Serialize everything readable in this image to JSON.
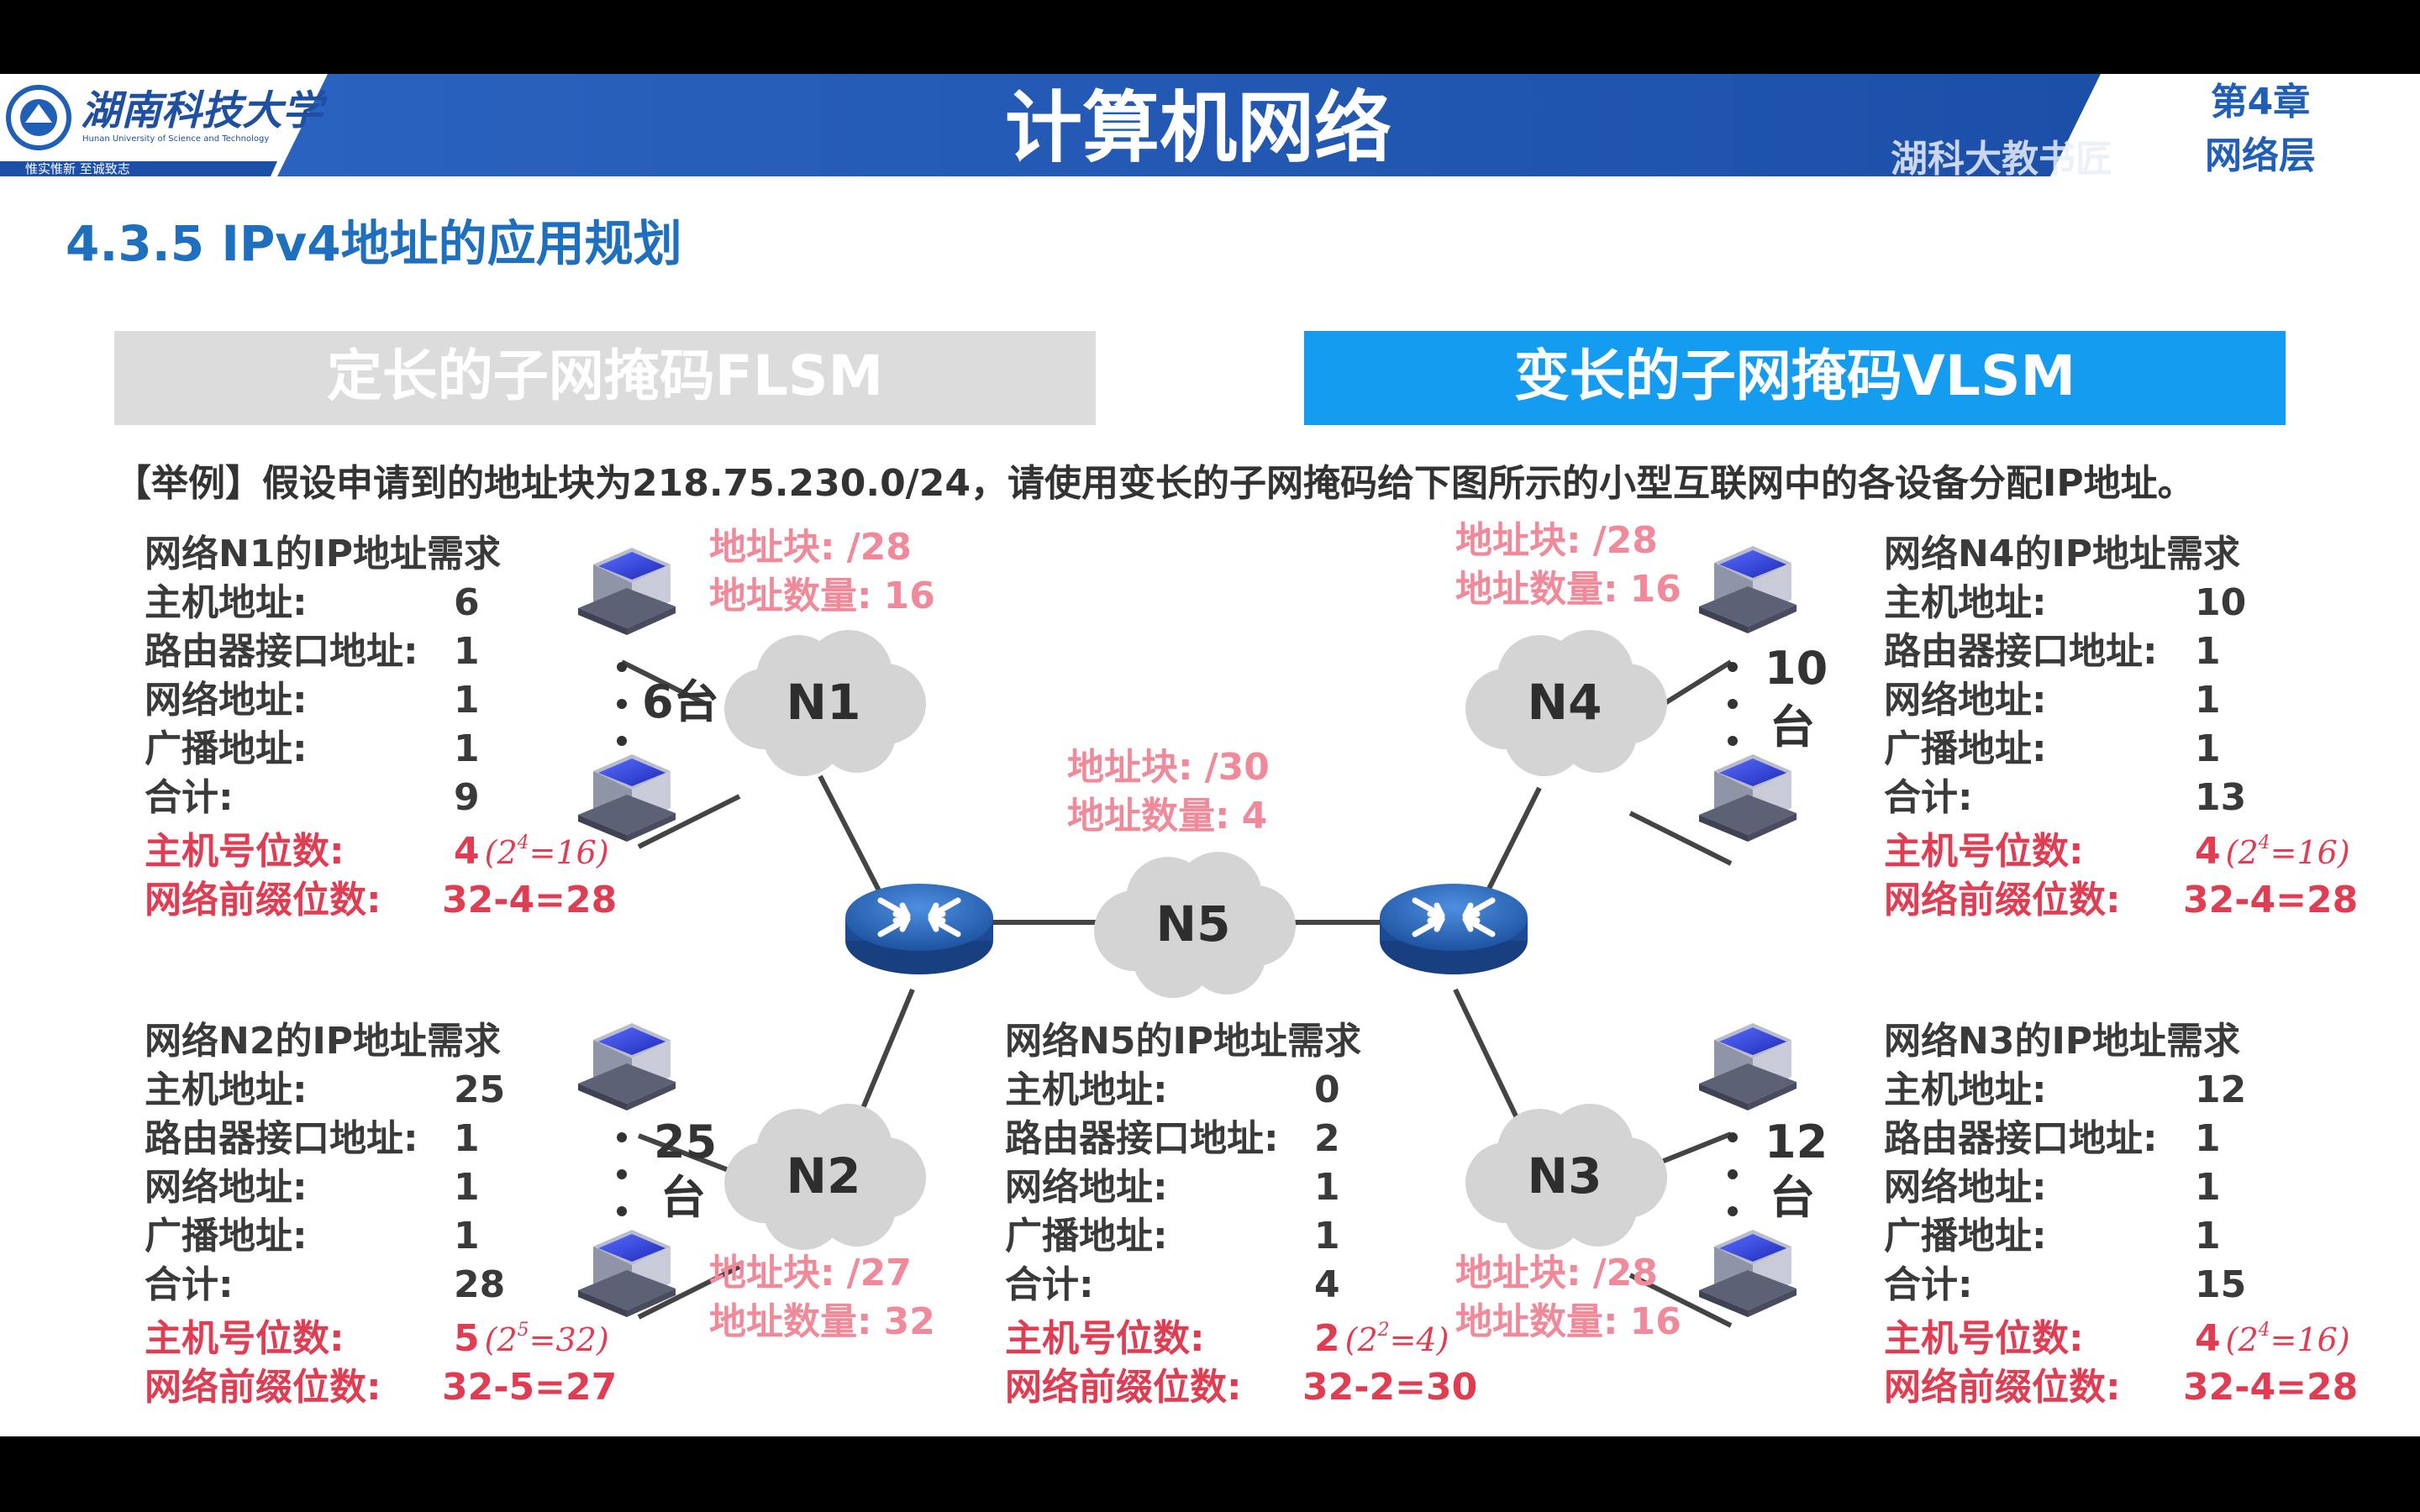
{
  "header": {
    "university_name": "湖南科技大学",
    "university_en": "Hunan University of Science and Technology",
    "motto": "惟实惟新    至诚致志",
    "course_title": "计算机网络",
    "chapter": "第4章",
    "chapter_sub": "网络层",
    "watermark": "湖科大教书匠"
  },
  "section_title": "4.3.5 IPv4地址的应用规划",
  "tabs": [
    {
      "label": "定长的子网掩码FLSM",
      "active": false
    },
    {
      "label": "变长的子网掩码VLSM",
      "active": true
    }
  ],
  "example_text": "【举例】假设申请到的地址块为218.75.230.0/24，请使用变长的子网掩码给下图所示的小型互联网中的各设备分配IP地址。",
  "colors": {
    "header_blue": "#1f5fb8",
    "active_tab": "#139cf0",
    "inactive_tab": "#dcdcdc",
    "section_title": "#1f6fbf",
    "red_label": "#e03c52",
    "pink_label": "#f08a9a"
  },
  "labels": {
    "host_addr": "主机地址:",
    "router_addr": "路由器接口地址:",
    "net_addr": "网络地址:",
    "bcast_addr": "广播地址:",
    "total": "合计:",
    "host_bits": "主机号位数:",
    "prefix_bits": "网络前缀位数:",
    "addr_block": "地址块:",
    "addr_count": "地址数量:"
  },
  "networks": {
    "N1": {
      "title": "网络N1的IP地址需求",
      "host": "6",
      "router": "1",
      "net": "1",
      "bcast": "1",
      "total": "9",
      "host_bits": "4",
      "pow_base": "(2",
      "pow_exp": "4",
      "pow_result": "=16)",
      "prefix": "32-4=28",
      "block": "/28",
      "count": "16",
      "hosts_label": "6台",
      "cloud": "N1"
    },
    "N2": {
      "title": "网络N2的IP地址需求",
      "host": "25",
      "router": "1",
      "net": "1",
      "bcast": "1",
      "total": "28",
      "host_bits": "5",
      "pow_base": "(2",
      "pow_exp": "5",
      "pow_result": "=32)",
      "prefix": "32-5=27",
      "block": "/27",
      "count": "32",
      "hosts_label_num": "25",
      "hosts_label_unit": "台",
      "cloud": "N2"
    },
    "N3": {
      "title": "网络N3的IP地址需求",
      "host": "12",
      "router": "1",
      "net": "1",
      "bcast": "1",
      "total": "15",
      "host_bits": "4",
      "pow_base": "(2",
      "pow_exp": "4",
      "pow_result": "=16)",
      "prefix": "32-4=28",
      "block": "/28",
      "count": "16",
      "hosts_label_num": "12",
      "hosts_label_unit": "台",
      "cloud": "N3"
    },
    "N4": {
      "title": "网络N4的IP地址需求",
      "host": "10",
      "router": "1",
      "net": "1",
      "bcast": "1",
      "total": "13",
      "host_bits": "4",
      "pow_base": "(2",
      "pow_exp": "4",
      "pow_result": "=16)",
      "prefix": "32-4=28",
      "block": "/28",
      "count": "16",
      "hosts_label_num": "10",
      "hosts_label_unit": "台",
      "cloud": "N4"
    },
    "N5": {
      "title": "网络N5的IP地址需求",
      "host": "0",
      "router": "2",
      "net": "1",
      "bcast": "1",
      "total": "4",
      "host_bits": "2",
      "pow_base": "(2",
      "pow_exp": "2",
      "pow_result": "=4)",
      "prefix": "32-2=30",
      "block": "/30",
      "count": "4",
      "cloud": "N5"
    }
  },
  "router_label": "ROUTER",
  "icons": [
    "university-logo-icon",
    "router-icon",
    "computer-icon",
    "cloud-icon"
  ]
}
